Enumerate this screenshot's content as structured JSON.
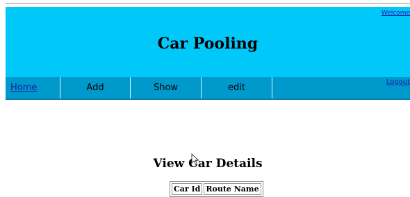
{
  "header": {
    "welcome_text": "Welcome",
    "site_title": "Car Pooling",
    "background_color": "#00c8f8"
  },
  "nav": {
    "items": [
      {
        "label": "Home"
      },
      {
        "label": "Add"
      },
      {
        "label": "Show"
      },
      {
        "label": "edit"
      }
    ],
    "logout_label": "Logout",
    "background_color": "#0099cc"
  },
  "main": {
    "heading": "View Car Details",
    "table": {
      "columns": [
        "Car Id",
        "Route Name"
      ]
    }
  }
}
